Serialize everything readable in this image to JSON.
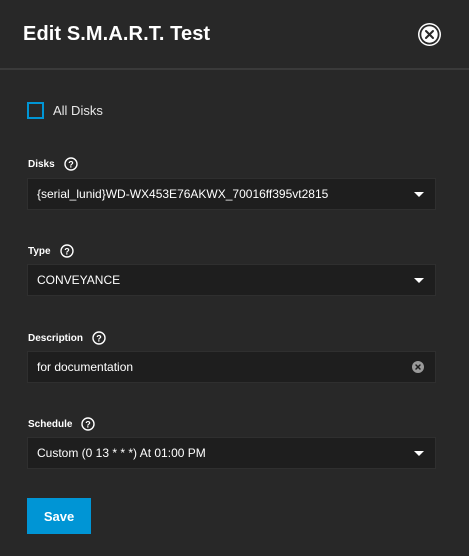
{
  "dialog": {
    "title": "Edit S.M.A.R.T. Test"
  },
  "all_disks": {
    "label": "All Disks",
    "checked": false
  },
  "disks": {
    "label": "Disks",
    "value": "{serial_lunid}WD-WX453E76AKWX_70016ff395vt2815"
  },
  "type": {
    "label": "Type",
    "value": "CONVEYANCE"
  },
  "description": {
    "label": "Description",
    "value": "for documentation"
  },
  "schedule": {
    "label": "Schedule",
    "value": "Custom (0 13 * * *) At 01:00 PM"
  },
  "actions": {
    "save_label": "Save"
  },
  "colors": {
    "background": "#282828",
    "field_background": "#1e1e1e",
    "accent": "#0095d5"
  },
  "icons": [
    "close-icon",
    "help-icon",
    "chevron-down-icon",
    "clear-icon"
  ]
}
